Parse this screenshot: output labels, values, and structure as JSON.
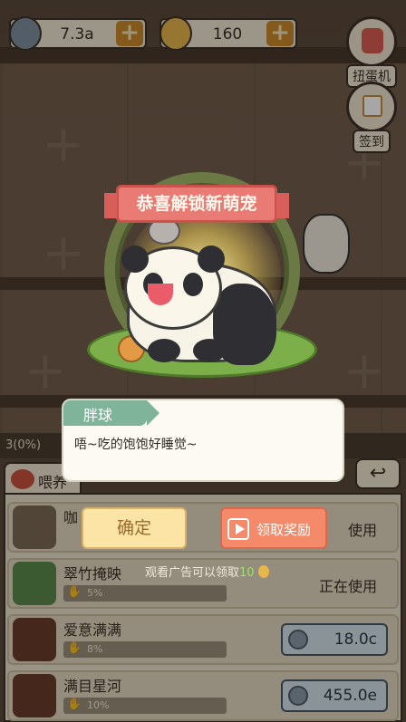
{
  "top_bar": {
    "gems": {
      "value": "7.3a",
      "icon": "gem-icon"
    },
    "coins": {
      "value": "160",
      "icon": "coin-icon"
    }
  },
  "side_buttons": [
    {
      "label": "扭蛋机",
      "icon": "gashapon-icon"
    },
    {
      "label": "签到",
      "icon": "calendar-icon"
    }
  ],
  "popup": {
    "banner": "恭喜解锁新萌宠",
    "pet_name": "胖球",
    "pet_quote": "唔~吃的饱饱好睡觉~",
    "confirm_label": "确定",
    "reward_label": "领取奖励",
    "ad_prefix": "观看广告可以领取",
    "ad_amount": "10"
  },
  "panel": {
    "counter": "3(0%)",
    "tab_feed": "喂养",
    "items": [
      {
        "name": "咖",
        "progress_text": "",
        "status": "使用",
        "type": "status"
      },
      {
        "name": "翠竹掩映",
        "progress_text": "5%",
        "status": "正在使用",
        "type": "status"
      },
      {
        "name": "爱意满满",
        "progress_text": "8%",
        "price": "18.0c",
        "type": "price"
      },
      {
        "name": "满目星河",
        "progress_text": "10%",
        "price": "455.0e",
        "type": "price"
      }
    ]
  },
  "colors": {
    "banner": "#e97a74",
    "confirm": "#fce3a6",
    "reward": "#f58a6a",
    "name_tag": "#7fb39a"
  }
}
